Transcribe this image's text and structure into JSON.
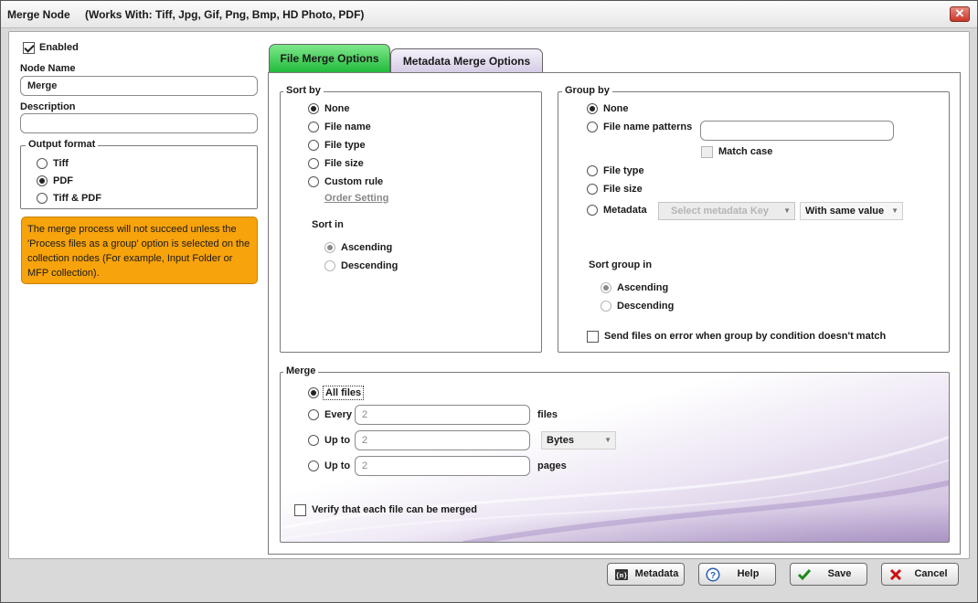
{
  "window": {
    "title": "Merge Node",
    "subtitle": "(Works With: Tiff, Jpg, Gif, Png, Bmp, HD Photo, PDF)",
    "close_label": "✕"
  },
  "left": {
    "enabled_label": "Enabled",
    "node_name_label": "Node Name",
    "node_name_value": "Merge",
    "description_label": "Description",
    "description_value": "",
    "output_format": {
      "legend": "Output format",
      "options": [
        "Tiff",
        "PDF",
        "Tiff & PDF"
      ],
      "selected": "PDF"
    },
    "note": "The merge process will not succeed unless the 'Process files as a group' option is selected on the collection nodes (For example, Input Folder or MFP collection)."
  },
  "tabs": [
    {
      "label": "File Merge Options",
      "active": true
    },
    {
      "label": "Metadata Merge Options",
      "active": false
    }
  ],
  "sort_by": {
    "legend": "Sort by",
    "options": [
      "None",
      "File name",
      "File type",
      "File size",
      "Custom rule"
    ],
    "selected": "None",
    "order_setting_label": "Order Setting",
    "sort_in_label": "Sort in",
    "sort_in_options": [
      "Ascending",
      "Descending"
    ],
    "sort_in_selected": "Ascending"
  },
  "group_by": {
    "legend": "Group by",
    "options": [
      "None",
      "File name patterns",
      "File type",
      "File size",
      "Metadata"
    ],
    "selected": "None",
    "pattern_value": "",
    "match_case_label": "Match case",
    "metadata_key_placeholder": "Select metadata Key",
    "metadata_condition": "With same value",
    "sort_group_in_label": "Sort group in",
    "sort_group_options": [
      "Ascending",
      "Descending"
    ],
    "sort_group_selected": "Ascending",
    "send_on_error_label": "Send files on error when group by condition doesn't match"
  },
  "merge": {
    "legend": "Merge",
    "all_files_label": "All files",
    "every_label": "Every",
    "every_value": "2",
    "every_unit": "files",
    "upto_size_label": "Up to",
    "upto_size_value": "2",
    "upto_size_unit": "Bytes",
    "upto_pages_label": "Up to",
    "upto_pages_value": "2",
    "upto_pages_unit": "pages",
    "selected": "All files",
    "verify_label": "Verify that each file can be merged"
  },
  "buttons": {
    "metadata": "Metadata",
    "help": "Help",
    "save": "Save",
    "cancel": "Cancel"
  },
  "colors": {
    "note_bg": "#f7a30c",
    "active_tab": "#1eb93a",
    "cancel_icon": "#cc1010",
    "save_icon": "#1b8a1b"
  }
}
